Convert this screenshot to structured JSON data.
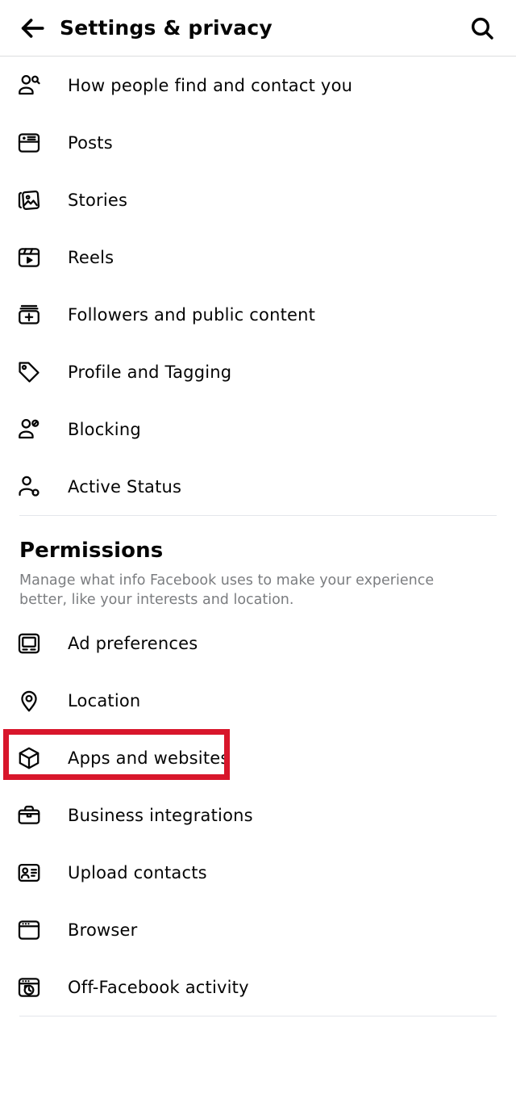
{
  "header": {
    "back_icon": "arrow-left-icon",
    "title": "Settings & privacy",
    "search_icon": "search-icon"
  },
  "privacy_list": [
    {
      "icon": "person-search-icon",
      "label": "How people find and contact you"
    },
    {
      "icon": "post-card-icon",
      "label": "Posts"
    },
    {
      "icon": "stories-photos-icon",
      "label": "Stories"
    },
    {
      "icon": "reels-clapper-icon",
      "label": "Reels"
    },
    {
      "icon": "followers-plus-icon",
      "label": "Followers and public content"
    },
    {
      "icon": "tag-icon",
      "label": "Profile and Tagging"
    },
    {
      "icon": "person-block-icon",
      "label": "Blocking"
    },
    {
      "icon": "person-active-icon",
      "label": "Active Status"
    }
  ],
  "permissions": {
    "title": "Permissions",
    "description": "Manage what info Facebook uses to make your experience better, like your interests and location.",
    "items": [
      {
        "icon": "monitor-icon",
        "label": "Ad preferences",
        "highlighted": false
      },
      {
        "icon": "location-pin-icon",
        "label": "Location",
        "highlighted": false
      },
      {
        "icon": "cube-icon",
        "label": "Apps and websites",
        "highlighted": true
      },
      {
        "icon": "briefcase-icon",
        "label": "Business integrations",
        "highlighted": false
      },
      {
        "icon": "contact-card-icon",
        "label": "Upload contacts",
        "highlighted": false
      },
      {
        "icon": "browser-window-icon",
        "label": "Browser",
        "highlighted": false
      },
      {
        "icon": "browser-clock-icon",
        "label": "Off-Facebook activity",
        "highlighted": false
      }
    ]
  },
  "colors": {
    "highlight_border": "#D8162B",
    "text_primary": "#050505",
    "text_secondary": "#7b7d80",
    "divider": "#e4e6eb"
  }
}
